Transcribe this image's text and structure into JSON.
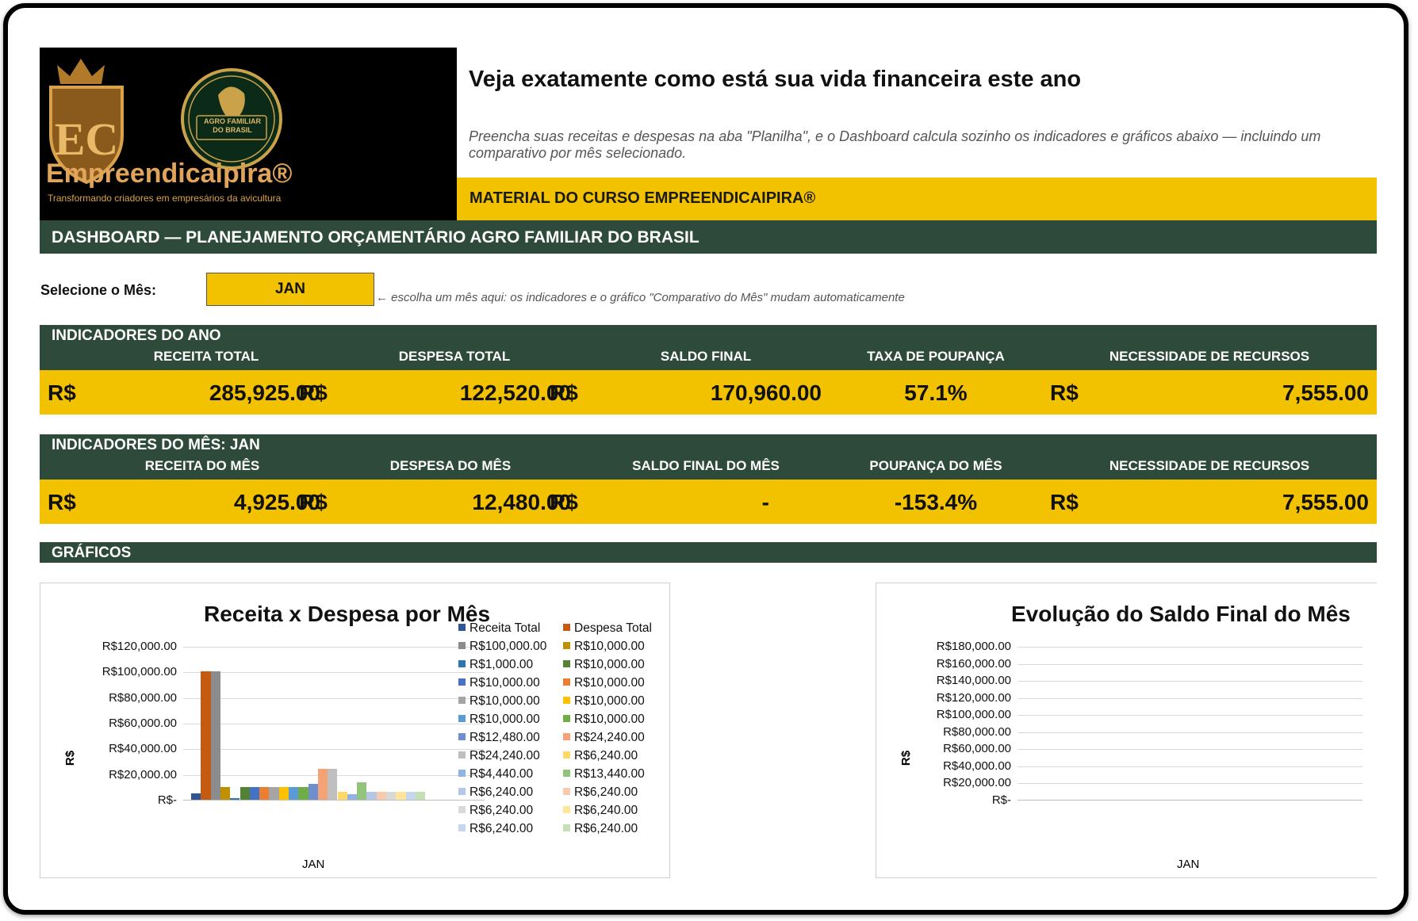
{
  "header": {
    "title": "Veja exatamente como está sua vida financeira este ano",
    "subtitle": "Preencha suas receitas e despesas na aba \"Planilha\", e o Dashboard calcula sozinho os indicadores e gráficos abaixo — incluindo um comparativo por mês selecionado.",
    "course": "MATERIAL DO CURSO EMPREENDICAIPIRA®",
    "logo_brand": "Empreendicaipira®",
    "logo_tagline": "Transformando criadores em empresários da avicultura",
    "seal_text": "AGRO FAMILIAR DO BRASIL"
  },
  "dashboard_title": "DASHBOARD — PLANEJAMENTO ORÇAMENTÁRIO AGRO FAMILIAR DO BRASIL",
  "selector": {
    "label": "Selecione o Mês:",
    "value": "JAN",
    "hint": "← escolha um mês aqui: os indicadores e o gráfico \"Comparativo do Mês\" mudam automaticamente"
  },
  "year_indicators": {
    "heading": "INDICADORES DO ANO",
    "columns": [
      "RECEITA TOTAL",
      "DESPESA TOTAL",
      "SALDO FINAL",
      "TAXA DE POUPANÇA",
      "NECESSIDADE DE RECURSOS"
    ],
    "currency": "R$",
    "values": [
      "285,925.00",
      "122,520.00",
      "170,960.00",
      "57.1%",
      "7,555.00"
    ]
  },
  "month_indicators": {
    "heading": "INDICADORES DO MÊS: JAN",
    "columns": [
      "RECEITA DO MÊS",
      "DESPESA DO MÊS",
      "SALDO FINAL DO MÊS",
      "POUPANÇA DO MÊS",
      "NECESSIDADE DE RECURSOS"
    ],
    "currency": "R$",
    "values": [
      "4,925.00",
      "12,480.00",
      "-",
      "-153.4%",
      "7,555.00"
    ]
  },
  "graficos_label": "GRÁFICOS",
  "chart_data": [
    {
      "type": "bar",
      "title": "Receita x Despesa por Mês",
      "ylabel": "R$",
      "categories": [
        "JAN"
      ],
      "ylim": [
        0,
        120000
      ],
      "yticks": [
        "R$-",
        "R$20,000.00",
        "R$40,000.00",
        "R$60,000.00",
        "R$80,000.00",
        "R$100,000.00",
        "R$120,000.00"
      ],
      "legend_position": "right",
      "legend": [
        {
          "label": "Receita Total",
          "color": "#2f5597"
        },
        {
          "label": "Despesa Total",
          "color": "#c55a11"
        },
        {
          "label": "R$100,000.00",
          "color": "#8c8c8c"
        },
        {
          "label": "R$10,000.00",
          "color": "#bf9000"
        },
        {
          "label": "R$1,000.00",
          "color": "#2e75b6"
        },
        {
          "label": "R$10,000.00",
          "color": "#548235"
        },
        {
          "label": "R$10,000.00",
          "color": "#4472c4"
        },
        {
          "label": "R$10,000.00",
          "color": "#ed7d31"
        },
        {
          "label": "R$10,000.00",
          "color": "#a5a5a5"
        },
        {
          "label": "R$10,000.00",
          "color": "#ffc000"
        },
        {
          "label": "R$10,000.00",
          "color": "#5b9bd5"
        },
        {
          "label": "R$10,000.00",
          "color": "#70ad47"
        },
        {
          "label": "R$12,480.00",
          "color": "#6f8ed0"
        },
        {
          "label": "R$24,240.00",
          "color": "#f4a276"
        },
        {
          "label": "R$24,240.00",
          "color": "#bfbfbf"
        },
        {
          "label": "R$6,240.00",
          "color": "#ffd966"
        },
        {
          "label": "R$4,440.00",
          "color": "#8fb4e3"
        },
        {
          "label": "R$13,440.00",
          "color": "#92c47d"
        },
        {
          "label": "R$6,240.00",
          "color": "#b4c7e7"
        },
        {
          "label": "R$6,240.00",
          "color": "#f8cbad"
        },
        {
          "label": "R$6,240.00",
          "color": "#d9d9d9"
        },
        {
          "label": "R$6,240.00",
          "color": "#ffe699"
        },
        {
          "label": "R$6,240.00",
          "color": "#c5d7ef"
        },
        {
          "label": "R$6,240.00",
          "color": "#c5e0b4"
        }
      ],
      "values": [
        4925,
        100000,
        100000,
        10000,
        1000,
        10000,
        10000,
        10000,
        10000,
        10000,
        10000,
        10000,
        12480,
        24240,
        24240,
        6240,
        4440,
        13440,
        6240,
        6240,
        6240,
        6240,
        6240,
        6240
      ]
    },
    {
      "type": "line",
      "title": "Evolução do Saldo Final do Mês",
      "ylabel": "R$",
      "categories": [
        "JAN"
      ],
      "ylim": [
        0,
        180000
      ],
      "yticks": [
        "R$-",
        "R$20,000.00",
        "R$40,000.00",
        "R$60,000.00",
        "R$80,000.00",
        "R$100,000.00",
        "R$120,000.00",
        "R$140,000.00",
        "R$160,000.00",
        "R$180,000.00"
      ],
      "values": [
        0
      ]
    }
  ]
}
